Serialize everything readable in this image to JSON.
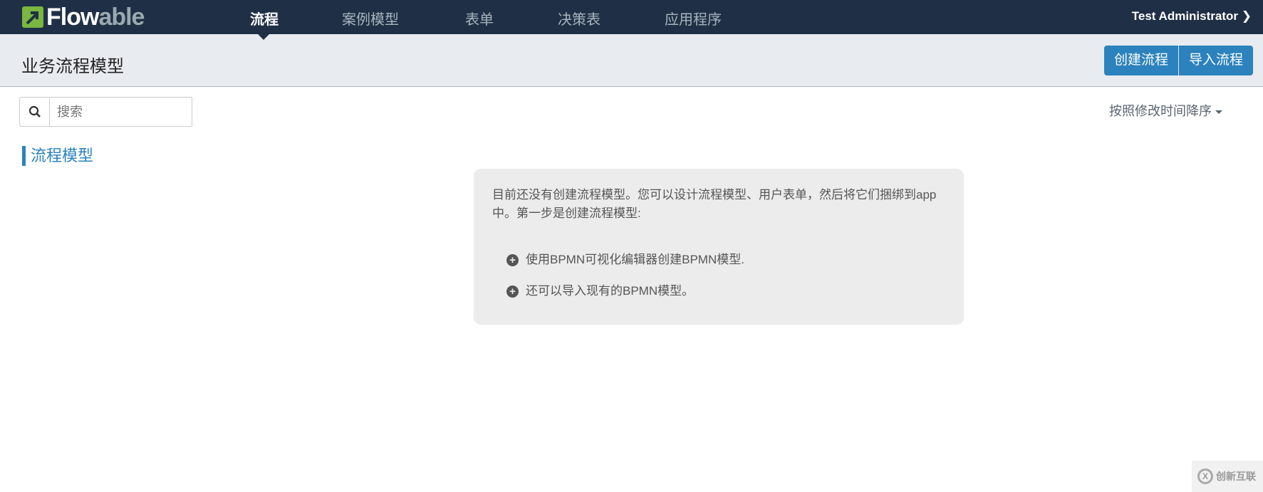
{
  "nav": {
    "logo": "Flowable",
    "items": [
      "流程",
      "案例模型",
      "表单",
      "决策表",
      "应用程序"
    ],
    "active": 0,
    "user": "Test Administrator"
  },
  "header": {
    "title": "业务流程模型",
    "create": "创建流程",
    "import": "导入流程"
  },
  "search": {
    "placeholder": "搜索"
  },
  "sort": {
    "label": "按照修改时间降序"
  },
  "sidebar": {
    "item": "流程模型"
  },
  "empty": {
    "intro": "目前还没有创建流程模型。您可以设计流程模型、用户表单，然后将它们捆绑到app中。第一步是创建流程模型:",
    "bullets": [
      "使用BPMN可视化编辑器创建BPMN模型.",
      "还可以导入现有的BPMN模型。"
    ]
  },
  "watermark": {
    "text": "创新互联"
  }
}
